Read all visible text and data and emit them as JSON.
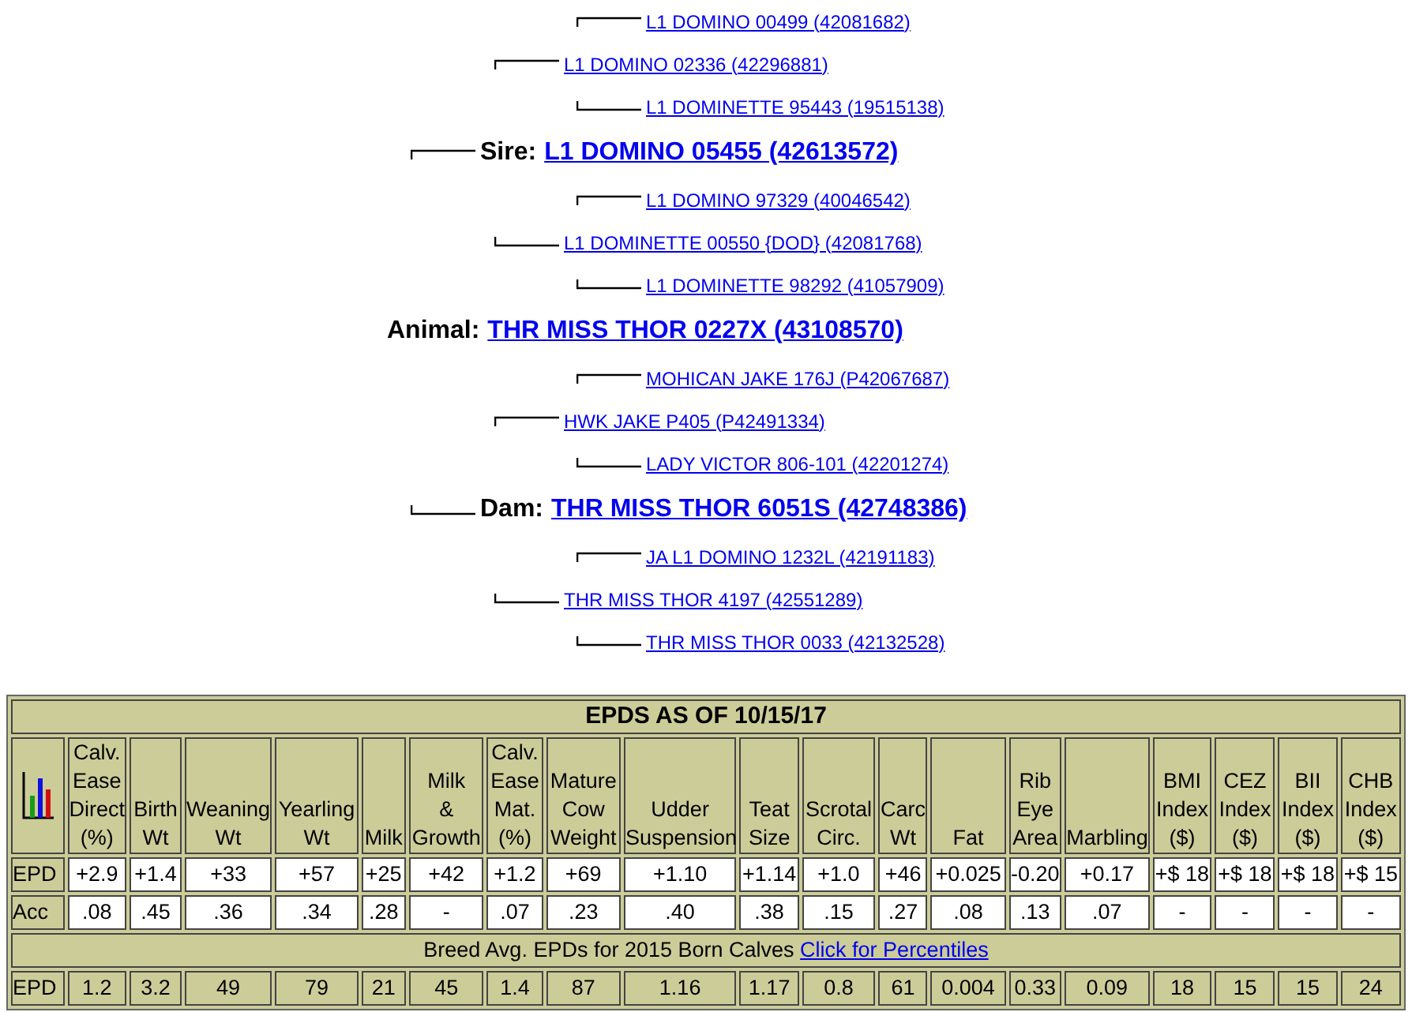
{
  "pedigree": {
    "label": "Animal:",
    "name": "THR MISS THOR 0227X (43108570)",
    "children": [
      {
        "label": "Sire:",
        "name": "L1 DOMINO 05455 (42613572)",
        "children": [
          {
            "name": "L1 DOMINO 02336 (42296881)",
            "children": [
              {
                "name": "L1 DOMINO 00499 (42081682)"
              },
              {
                "name": "L1 DOMINETTE 95443 (19515138)"
              }
            ]
          },
          {
            "name": "L1 DOMINETTE 00550 {DOD} (42081768)",
            "children": [
              {
                "name": "L1 DOMINO 97329 (40046542)"
              },
              {
                "name": "L1 DOMINETTE 98292 (41057909)"
              }
            ]
          }
        ]
      },
      {
        "label": "Dam:",
        "name": "THR MISS THOR 6051S (42748386)",
        "children": [
          {
            "name": "HWK JAKE P405 (P42491334)",
            "children": [
              {
                "name": "MOHICAN JAKE 176J (P42067687)"
              },
              {
                "name": "LADY VICTOR 806-101 (42201274)"
              }
            ]
          },
          {
            "name": "THR MISS THOR 4197 (42551289)",
            "children": [
              {
                "name": "JA L1 DOMINO 1232L (42191183)"
              },
              {
                "name": "THR MISS THOR 0033 (42132528)"
              }
            ]
          }
        ]
      }
    ]
  },
  "epd_table": {
    "title": "EPDS AS OF 10/15/17",
    "columns": [
      "Calv.\nEase\nDirect\n(%)",
      "Birth\nWt",
      "Weaning\nWt",
      "Yearling\nWt",
      "Milk",
      "Milk\n&\nGrowth",
      "Calv.\nEase\nMat.\n(%)",
      "Mature\nCow\nWeight",
      "Udder\nSuspension",
      "Teat\nSize",
      "Scrotal\nCirc.",
      "Carc\nWt",
      "Fat",
      "Rib\nEye\nArea",
      "Marbling",
      "BMI\nIndex\n($)",
      "CEZ\nIndex\n($)",
      "BII\nIndex\n($)",
      "CHB\nIndex\n($)"
    ],
    "rows": [
      {
        "kind": "animal",
        "label": "EPD",
        "values": [
          "+2.9",
          "+1.4",
          "+33",
          "+57",
          "+25",
          "+42",
          "+1.2",
          "+69",
          "+1.10",
          "+1.14",
          "+1.0",
          "+46",
          "+0.025",
          "-0.20",
          "+0.17",
          "+$ 18",
          "+$ 18",
          "+$ 18",
          "+$ 15"
        ]
      },
      {
        "kind": "animal",
        "label": "Acc",
        "values": [
          ".08",
          ".45",
          ".36",
          ".34",
          ".28",
          "-",
          ".07",
          ".23",
          ".40",
          ".38",
          ".15",
          ".27",
          ".08",
          ".13",
          ".07",
          "-",
          "-",
          "-",
          "-"
        ]
      }
    ],
    "breed_caption": "Breed Avg. EPDs for 2015 Born Calves",
    "breed_link": "Click for Percentiles",
    "breed_rows": [
      {
        "kind": "breed",
        "label": "EPD",
        "values": [
          "1.2",
          "3.2",
          "49",
          "79",
          "21",
          "45",
          "1.4",
          "87",
          "1.16",
          "1.17",
          "0.8",
          "61",
          "0.004",
          "0.33",
          "0.09",
          "18",
          "15",
          "15",
          "24"
        ]
      }
    ]
  }
}
